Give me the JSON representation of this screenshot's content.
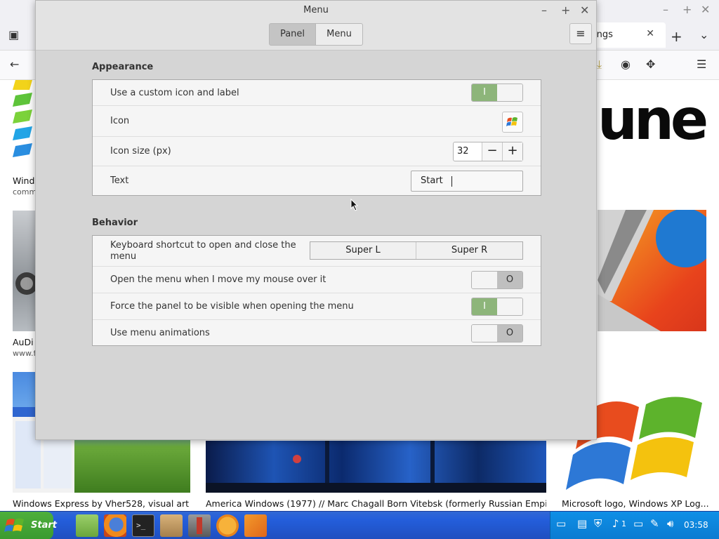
{
  "dialog": {
    "title": "Menu",
    "tabs": [
      "Panel",
      "Menu"
    ],
    "appearance": {
      "heading": "Appearance",
      "custom_icon_label": "Use a custom icon and label",
      "icon_label": "Icon",
      "icon_size_label": "Icon size (px)",
      "icon_size_value": "32",
      "text_label": "Text",
      "text_value": "Start"
    },
    "behavior": {
      "heading": "Behavior",
      "shortcut_label": "Keyboard shortcut to open and close the menu",
      "shortcut_1": "Super L",
      "shortcut_2": "Super R",
      "hover_label": "Open the menu when I move my mouse over it",
      "force_panel_label": "Force the panel to be visible when opening the menu",
      "animations_label": "Use menu animations"
    },
    "switch_on_glyph": "I",
    "switch_off_glyph": "O",
    "minus_glyph": "−",
    "plus_glyph": "+"
  },
  "browser": {
    "tab_label": "ings",
    "captions": {
      "left_top": "Wind",
      "left_top_sub": "comm",
      "left_mid": "AuDi",
      "left_mid_sub": "www.fl",
      "bottom_1": "Windows Express by Vher528, visual art",
      "bottom_2": "America Windows (1977) // Marc Chagall Born Vitebsk (formerly Russian Empi...",
      "bottom_3": "Microsoft logo, Windows XP Log..."
    },
    "image_text": "une"
  },
  "taskbar": {
    "start_label": "Start",
    "clock": "03:58",
    "tray_badge": "1"
  },
  "colors": {
    "switch_on": "#8db57a",
    "taskbar_blue": "#245edb",
    "start_green": "#3a9a2f"
  }
}
